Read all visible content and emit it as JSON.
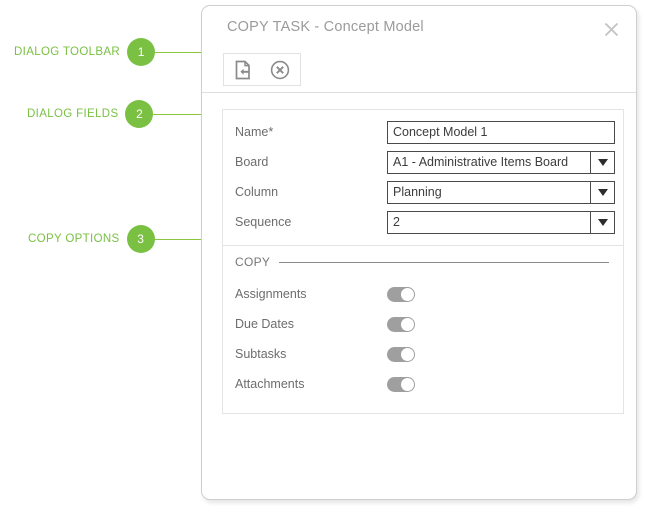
{
  "annotations": [
    {
      "number": "1",
      "label": "DIALOG TOOLBAR",
      "target": "dialog-toolbar"
    },
    {
      "number": "2",
      "label": "DIALOG FIELDS",
      "target": "dialog-fields"
    },
    {
      "number": "3",
      "label": "COPY OPTIONS",
      "target": "copy-options"
    }
  ],
  "dialog": {
    "title": "COPY TASK - Concept Model",
    "close_icon": "close-x-icon",
    "toolbar": {
      "buttons": [
        {
          "name": "save-and-close-icon",
          "label": "Save and Close"
        },
        {
          "name": "cancel-circle-x-icon",
          "label": "Cancel"
        }
      ]
    },
    "fields": [
      {
        "label": "Name*",
        "type": "text",
        "value": "Concept Model 1",
        "placeholder": ""
      },
      {
        "label": "Board",
        "type": "select",
        "value": "A1 - Administrative Items Board"
      },
      {
        "label": "Column",
        "type": "select",
        "value": "Planning"
      },
      {
        "label": "Sequence",
        "type": "select",
        "value": "2"
      }
    ],
    "copy_section": {
      "legend": "COPY",
      "options": [
        {
          "label": "Assignments",
          "state": "on"
        },
        {
          "label": "Due Dates",
          "state": "on"
        },
        {
          "label": "Subtasks",
          "state": "on"
        },
        {
          "label": "Attachments",
          "state": "on"
        }
      ]
    }
  },
  "colors": {
    "accent_green": "#7ac143",
    "dialog_border": "#cfcfcf",
    "label_gray": "#6d6d6d",
    "title_gray": "#9b9b9b",
    "toggle_track": "#9f9f9f"
  }
}
